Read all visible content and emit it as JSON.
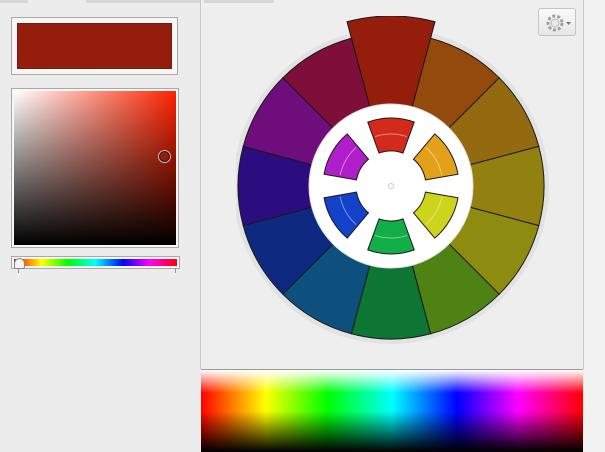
{
  "selected_color": "#951D0C",
  "wheel": {
    "outer_segments": [
      {
        "hue": "red",
        "color": "#951D0C",
        "selected": true
      },
      {
        "hue": "red-orange",
        "color": "#944A0D"
      },
      {
        "hue": "orange",
        "color": "#936A0F"
      },
      {
        "hue": "yellow-orange",
        "color": "#928010"
      },
      {
        "hue": "yellow",
        "color": "#8D8C10"
      },
      {
        "hue": "yellow-green",
        "color": "#4E8313"
      },
      {
        "hue": "green",
        "color": "#0D7635"
      },
      {
        "hue": "blue-green",
        "color": "#0D507D"
      },
      {
        "hue": "blue",
        "color": "#0D2A80"
      },
      {
        "hue": "blue-violet",
        "color": "#2C0D7F"
      },
      {
        "hue": "violet",
        "color": "#6E0D7B"
      },
      {
        "hue": "red-violet",
        "color": "#7E0F3A"
      }
    ],
    "inner_swatches": [
      {
        "name": "red",
        "color": "#D42A1B"
      },
      {
        "name": "orange",
        "color": "#E3A11A"
      },
      {
        "name": "yellow",
        "color": "#CCD51C"
      },
      {
        "name": "green",
        "color": "#12AE49"
      },
      {
        "name": "blue",
        "color": "#1441C9"
      },
      {
        "name": "violet",
        "color": "#B01EC9"
      }
    ]
  },
  "hue_slider": {
    "value_degrees": 6
  },
  "icons": {
    "menu": "gear-icon",
    "menu_arrow": "caret-down-icon"
  }
}
